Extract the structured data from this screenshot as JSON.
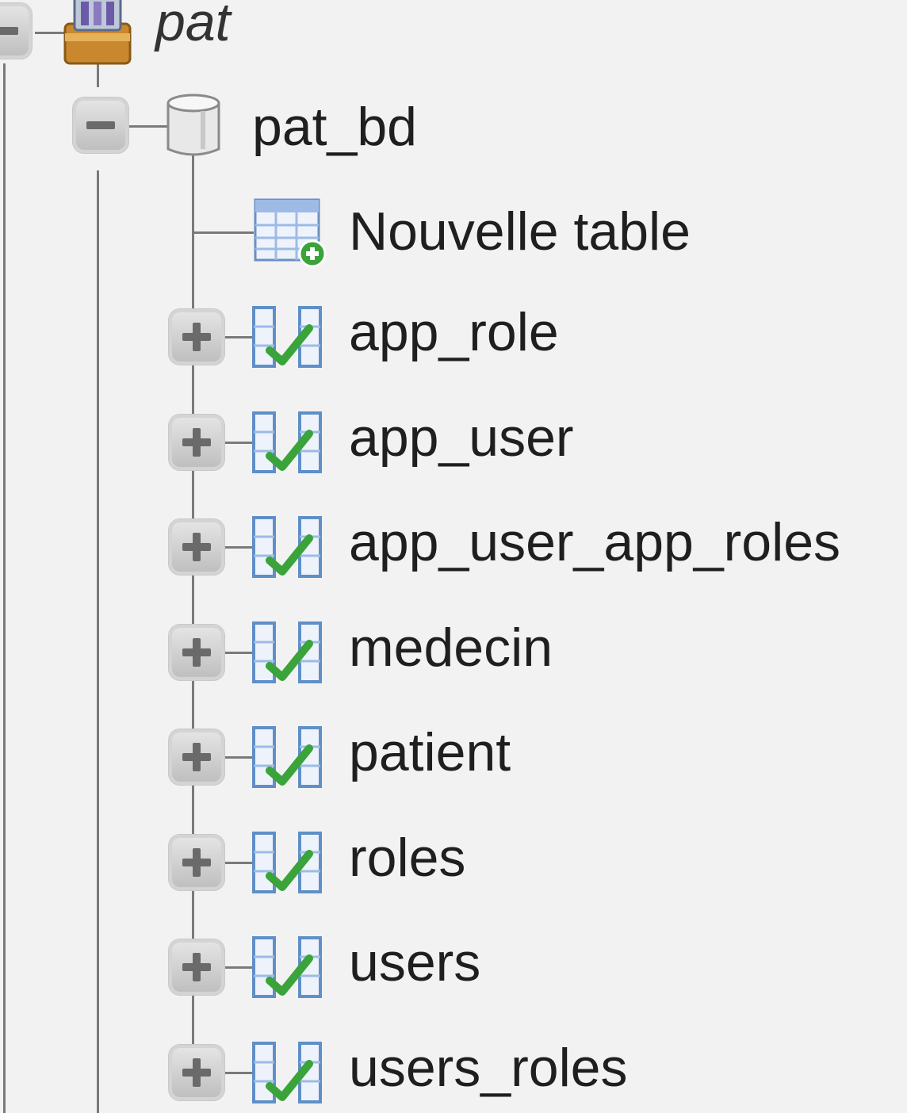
{
  "server": {
    "label": "pat"
  },
  "database": {
    "label": "pat_bd"
  },
  "new_table": {
    "label": "Nouvelle table"
  },
  "tables": [
    {
      "label": "app_role"
    },
    {
      "label": "app_user"
    },
    {
      "label": "app_user_app_roles"
    },
    {
      "label": "medecin"
    },
    {
      "label": "patient"
    },
    {
      "label": "roles"
    },
    {
      "label": "users"
    },
    {
      "label": "users_roles"
    }
  ],
  "icons": {
    "server": "server-box-icon",
    "database": "database-cylinder-icon",
    "new_table": "new-table-icon",
    "table": "table-view-icon",
    "expand": "plus-icon",
    "collapse": "minus-icon"
  },
  "colors": {
    "background": "#f2f2f2",
    "tree_line": "#7a7a7a",
    "text": "#1f1f1f",
    "icon_green": "#3aa33a",
    "icon_blue": "#4a86c5"
  }
}
